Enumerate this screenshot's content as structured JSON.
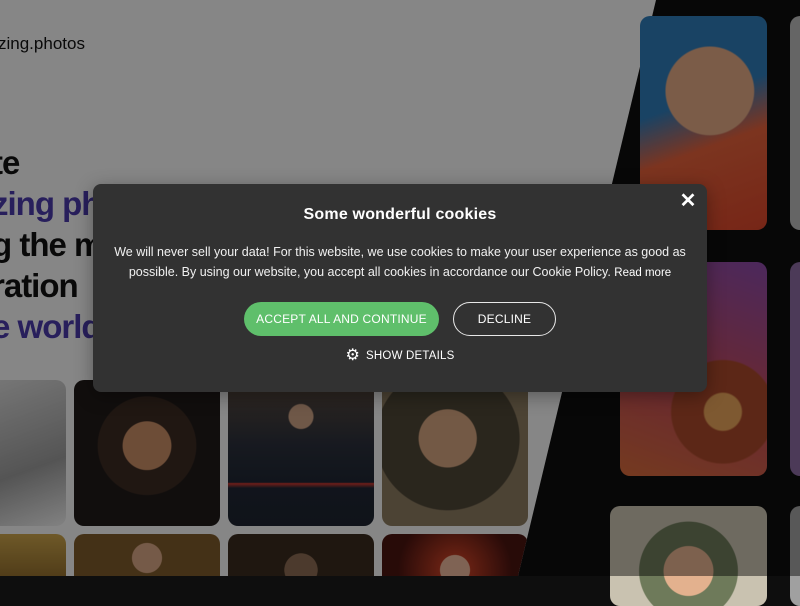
{
  "site": {
    "brand": "zing.photos",
    "headline": [
      "te",
      "zing ph",
      "g the m",
      "ration",
      "e world"
    ]
  },
  "cookie": {
    "title": "Some wonderful cookies",
    "body": "We will never sell your data! For this website, we use cookies to make your user experience as good as possible. By using our website, you accept all cookies in accordance our Cookie Policy.",
    "read_more": "Read more",
    "accept_label": "ACCEPT ALL AND CONTINUE",
    "decline_label": "DECLINE",
    "details_label": "SHOW DETAILS",
    "close_glyph": "✕",
    "details_icon": "gear-icon"
  },
  "colors": {
    "accent_green": "#5fbf6b",
    "headline_purple": "#4a3aa8",
    "dialog_bg": "#323232"
  }
}
